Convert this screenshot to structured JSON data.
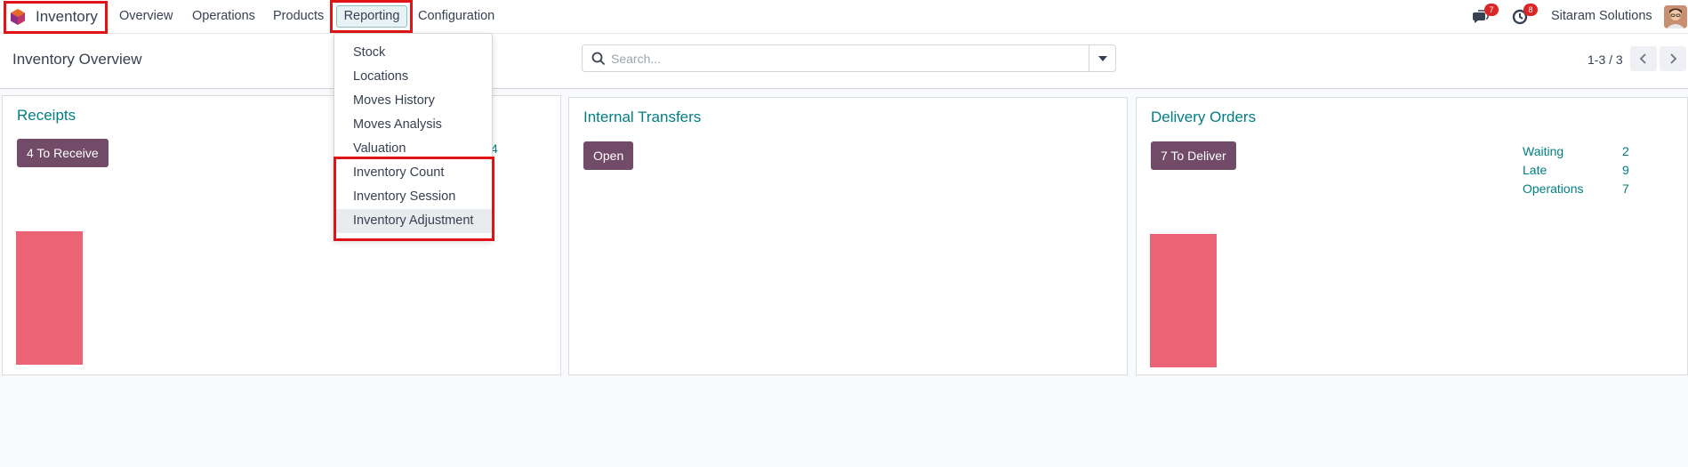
{
  "app": {
    "name": "Inventory",
    "accent": "#017e84",
    "brand_button": "#714b67"
  },
  "nav": {
    "items": [
      "Overview",
      "Operations",
      "Products",
      "Reporting",
      "Configuration"
    ]
  },
  "systray": {
    "messages_count": "7",
    "activities_count": "8",
    "company": "Sitaram Solutions"
  },
  "control_panel": {
    "title": "Inventory Overview",
    "search_placeholder": "Search...",
    "pager": "1-3 / 3"
  },
  "reporting_menu": {
    "items": [
      "Stock",
      "Locations",
      "Moves History",
      "Moves Analysis",
      "Valuation",
      "Inventory Count",
      "Inventory Session",
      "Inventory Adjustment"
    ],
    "hovered": "Inventory Adjustment"
  },
  "cards": [
    {
      "title": "Receipts",
      "button": "4 To Receive",
      "partial_value": "4",
      "bar_color": "#eb6475"
    },
    {
      "title": "Internal Transfers",
      "button": "Open"
    },
    {
      "title": "Delivery Orders",
      "button": "7 To Deliver",
      "stats": [
        {
          "label": "Waiting",
          "value": "2"
        },
        {
          "label": "Late",
          "value": "9"
        },
        {
          "label": "Operations",
          "value": "7"
        }
      ],
      "bar_color": "#eb6475"
    }
  ]
}
